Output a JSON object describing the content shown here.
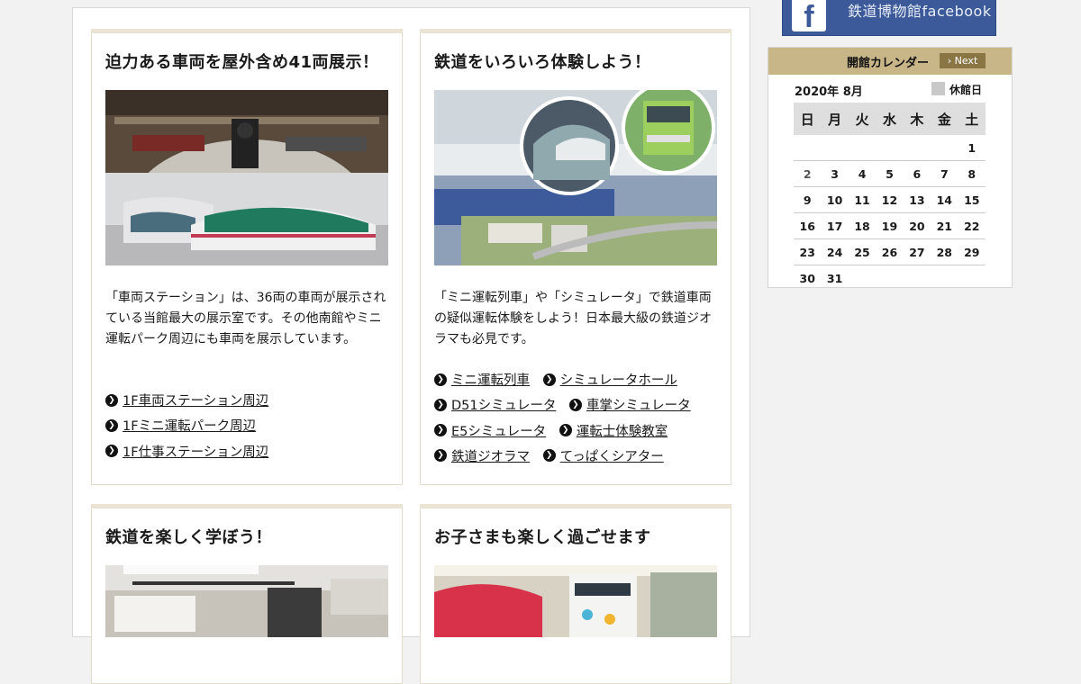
{
  "cards": [
    {
      "title": "迫力ある車両を屋外含め41両展示！",
      "description": "「車両ステーション」は、36両の車両が展示されている当館最大の展示室です。その他南館やミニ運転パーク周辺にも車両を展示しています。",
      "links": [
        "1F車両ステーション周辺",
        "1Fミニ運転パーク周辺",
        "1F仕事ステーション周辺"
      ]
    },
    {
      "title": "鉄道をいろいろ体験しよう！",
      "description": "「ミニ運転列車」や「シミュレータ」で鉄道車両の疑似運転体験をしよう！日本最大級の鉄道ジオラマも必見です。",
      "links": [
        "ミニ運転列車",
        "シミュレータホール",
        "D51シミュレータ",
        "車掌シミュレータ",
        "E5シミュレータ",
        "運転士体験教室",
        "鉄道ジオラマ",
        "てっぱくシアター"
      ]
    },
    {
      "title": "鉄道を楽しく学ぼう！"
    },
    {
      "title": "お子さまも楽しく過ごせます"
    }
  ],
  "sidebar": {
    "facebook_label": "鉄道博物館facebook",
    "facebook_logo": "f",
    "calendar": {
      "title": "開館カレンダー",
      "next_label": "Next",
      "month_label": "2020年 8月",
      "closed_legend": "休館日",
      "weekdays": [
        "日",
        "月",
        "火",
        "水",
        "木",
        "金",
        "土"
      ],
      "weeks": [
        [
          "",
          "",
          "",
          "",
          "",
          "",
          "1"
        ],
        [
          "2",
          "3",
          "4",
          "5",
          "6",
          "7",
          "8"
        ],
        [
          "9",
          "10",
          "11",
          "12",
          "13",
          "14",
          "15"
        ],
        [
          "16",
          "17",
          "18",
          "19",
          "20",
          "21",
          "22"
        ],
        [
          "23",
          "24",
          "25",
          "26",
          "27",
          "28",
          "29"
        ],
        [
          "30",
          "31",
          "",
          "",
          "",
          "",
          ""
        ]
      ]
    }
  },
  "colors": {
    "card_top_border": "#ebe4d4",
    "calendar_header": "#c9b688",
    "next_button": "#8a7545",
    "facebook_blue": "#3c5a99",
    "closed_day": "#c8c8c8"
  }
}
